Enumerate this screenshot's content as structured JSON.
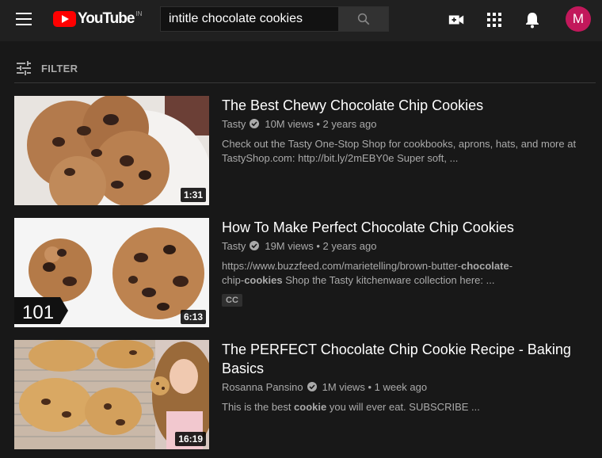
{
  "header": {
    "logo_text": "YouTube",
    "region": "IN",
    "search_value": "intitle chocolate cookies",
    "avatar_letter": "M",
    "icons": [
      "menu-icon",
      "search-icon",
      "create-video-icon",
      "apps-icon",
      "notifications-icon"
    ]
  },
  "filter": {
    "label": "FILTER"
  },
  "results": [
    {
      "title": "The Best Chewy Chocolate Chip Cookies",
      "channel": "Tasty",
      "views": "10M views",
      "age": "2 years ago",
      "desc_1": "Check out the Tasty One-Stop Shop for cookbooks, aprons, hats, and more at TastyShop.com: http://bit.ly/2mEBY0e Super soft, ...",
      "duration": "1:31"
    },
    {
      "title": "How To Make Perfect Chocolate Chip Cookies",
      "channel": "Tasty",
      "views": "19M views",
      "age": "2 years ago",
      "desc_a": "https://www.buzzfeed.com/marietelling/brown-butter-",
      "desc_b": "chocolate",
      "desc_c": "-",
      "desc_d": "chip-",
      "desc_e": "cookies",
      "desc_f": " Shop the Tasty kitchenware collection here: ...",
      "badge": "CC",
      "thumb_overlay": "101",
      "duration": "6:13"
    },
    {
      "title": "The PERFECT Chocolate Chip Cookie Recipe - Baking Basics",
      "channel": "Rosanna Pansino",
      "views": "1M views",
      "age": "1 week ago",
      "desc_a": "This is the best ",
      "desc_b": "cookie",
      "desc_c": " you will ever eat. SUBSCRIBE ...",
      "duration": "16:19"
    }
  ],
  "colors": {
    "background": "#181818",
    "topbar": "#202020",
    "logo_red": "#ff0000",
    "avatar": "#c2185b",
    "secondary_text": "#aaaaaa"
  }
}
